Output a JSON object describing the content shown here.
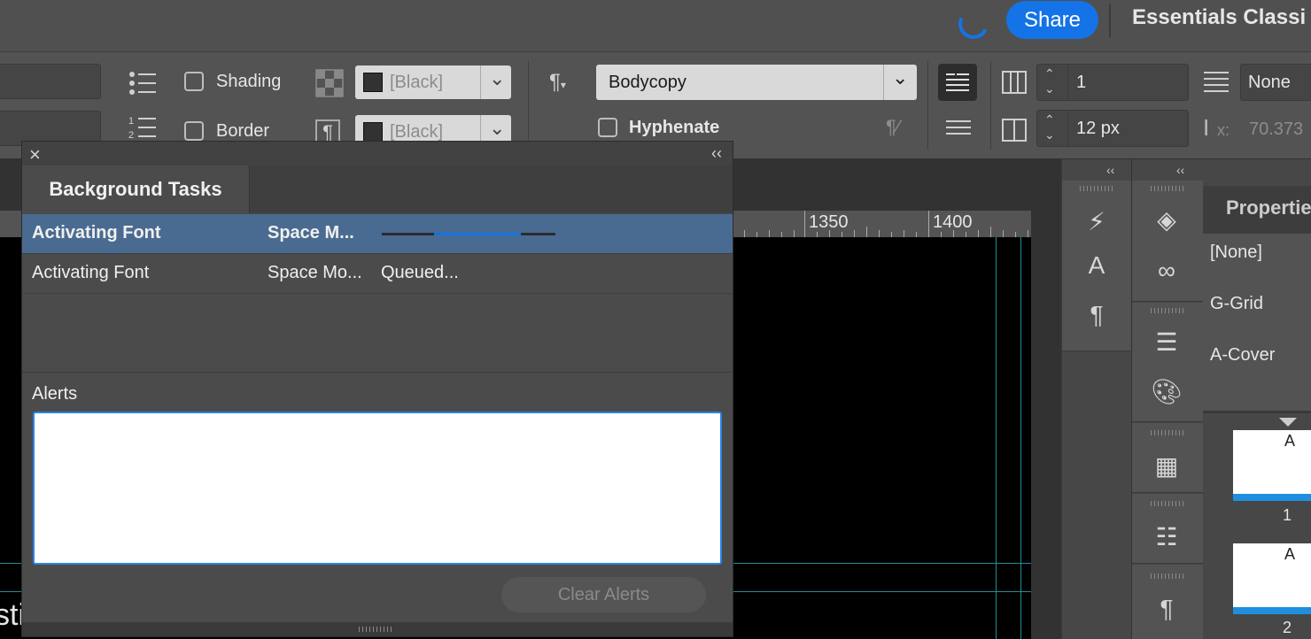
{
  "topbar": {
    "share_label": "Share",
    "workspace": "Essentials Classi"
  },
  "controlbar": {
    "shading_label": "Shading",
    "border_label": "Border",
    "shading_color": "[Black]",
    "border_color": "[Black]",
    "paragraph_style": "Bodycopy",
    "hyphenate_label": "Hyphenate",
    "columns_value": "1",
    "gutter_value": "12 px",
    "span_value": "None",
    "x_label": "x:",
    "x_value": "70.373"
  },
  "ruler": {
    "labels": [
      "1350",
      "1400"
    ]
  },
  "canvas": {
    "partial_text": "sti"
  },
  "background_tasks": {
    "title": "Background Tasks",
    "close_glyph": "×",
    "collapse_glyph": "‹‹",
    "tasks": [
      {
        "name": "Activating Font",
        "font": "Space M...",
        "status": "",
        "progress": 0.5
      },
      {
        "name": "Activating Font",
        "font": "Space Mo...",
        "status": "Queued..."
      }
    ],
    "alerts_label": "Alerts",
    "clear_alerts_label": "Clear Alerts"
  },
  "properties_panel": {
    "title": "Properties",
    "masters": [
      "[None]",
      "G-Grid",
      "A-Cover"
    ],
    "pages": [
      {
        "master": "A",
        "number": "1"
      },
      {
        "master": "A",
        "number": "2"
      }
    ]
  },
  "panel_collapse_glyph": "‹‹",
  "colors": {
    "accent": "#1473e6",
    "selected_row": "#4a6b91",
    "guide": "#1e8e9c"
  }
}
